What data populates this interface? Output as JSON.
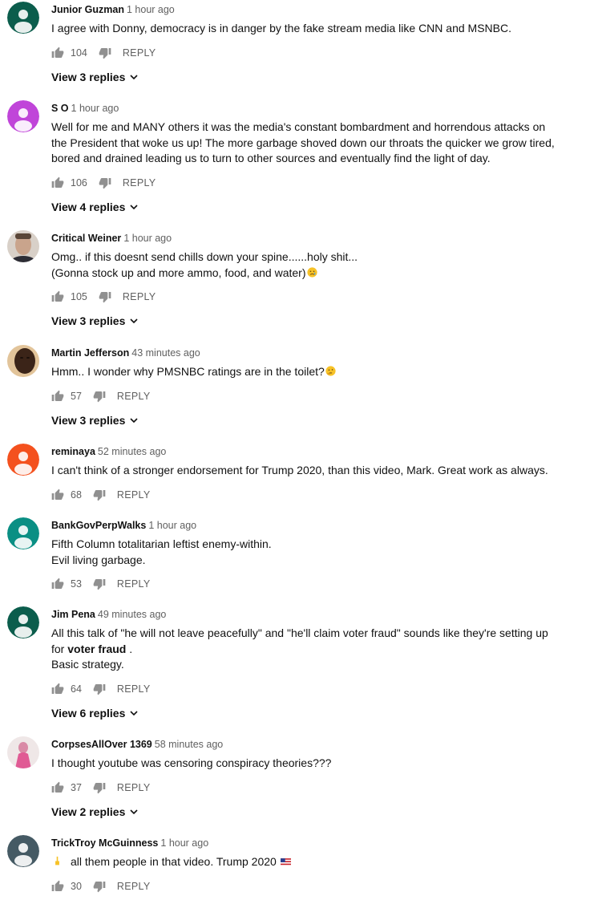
{
  "comments": [
    {
      "author": "Junior Guzman",
      "time": "1 hour ago",
      "lines": [
        "I agree with Donny, democracy is in danger by the fake stream media like CNN and MSNBC."
      ],
      "likes": "104",
      "reply": "REPLY",
      "replies": "View 3 replies",
      "avatar_color": "#0b5d4c",
      "avatar": "person"
    },
    {
      "author": "S O",
      "time": "1 hour ago",
      "lines": [
        "Well for me and MANY others it was the media's constant bombardment and horrendous attacks on",
        "the President that woke us up! The more garbage shoved down our throats the quicker we grow tired,",
        "bored and drained leading us to turn to other sources and eventually find the light of day."
      ],
      "likes": "106",
      "reply": "REPLY",
      "replies": "View 4 replies",
      "avatar_color": "#c045d9",
      "avatar": "person"
    },
    {
      "author": "Critical Weiner",
      "time": "1 hour ago",
      "lines": [
        "Omg.. if this doesnt send chills down your spine......holy shit...",
        "(Gonna stock up and more ammo, food, and water)"
      ],
      "likes": "105",
      "reply": "REPLY",
      "replies": "View 3 replies",
      "avatar_color": "#b9a79b",
      "avatar": "photo-face-light"
    },
    {
      "author": "Martin Jefferson",
      "time": "43 minutes ago",
      "lines": [
        "Hmm.. I wonder why PMSNBC ratings are in the toilet?"
      ],
      "likes": "57",
      "reply": "REPLY",
      "replies": "View 3 replies",
      "avatar_color": "#3b2418",
      "avatar": "photo-face-dark"
    },
    {
      "author": "reminaya",
      "time": "52 minutes ago",
      "lines": [
        "I can't think of a stronger endorsement for Trump 2020, than this video, Mark. Great work as always."
      ],
      "likes": "68",
      "reply": "REPLY",
      "replies": "",
      "avatar_color": "#f4511e",
      "avatar": "person"
    },
    {
      "author": "BankGovPerpWalks",
      "time": "1 hour ago",
      "lines": [
        "Fifth Column totalitarian leftist enemy-within.",
        "Evil living garbage."
      ],
      "likes": "53",
      "reply": "REPLY",
      "replies": "",
      "avatar_color": "#0a8f84",
      "avatar": "person"
    },
    {
      "author": "Jim Pena",
      "time": "49 minutes ago",
      "lines": [
        "All this talk of \"he will not leave peacefully\" and \"he'll claim voter fraud\" sounds like they're setting up"
      ],
      "line2_bold": "voter fraud",
      "line2_pre": "for ",
      "line2_post": " .",
      "line3": "Basic strategy.",
      "likes": "64",
      "reply": "REPLY",
      "replies": "View 6 replies",
      "avatar_color": "#0b5d4c",
      "avatar": "person"
    },
    {
      "author": "CorpsesAllOver 1369",
      "time": "58 minutes ago",
      "lines": [
        "I thought youtube was censoring conspiracy theories???"
      ],
      "likes": "37",
      "reply": "REPLY",
      "replies": "View 2 replies",
      "avatar_color": "#d9c3c7",
      "avatar": "photo-pink"
    },
    {
      "author": "TrickTroy McGuinness",
      "time": "1 hour ago",
      "lines": [
        "all them people in that video.  Trump 2020"
      ],
      "likes": "30",
      "reply": "REPLY",
      "replies": "",
      "avatar_color": "#455a64",
      "avatar": "person"
    }
  ],
  "icons": {
    "like": "thumbs-up-icon",
    "dislike": "thumbs-down-icon",
    "chevron": "chevron-down-icon"
  }
}
